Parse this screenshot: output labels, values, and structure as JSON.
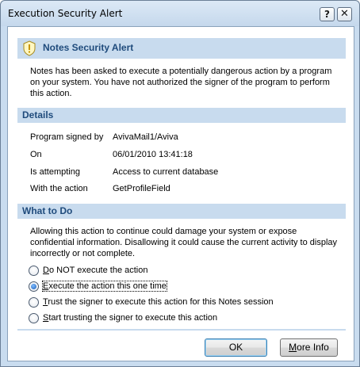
{
  "window": {
    "title": "Execution Security Alert",
    "help_glyph": "?",
    "close_glyph": "✕"
  },
  "alert": {
    "title": "Notes Security Alert",
    "message": "Notes has been asked to execute a potentially dangerous action by a program on your system.  You have not authorized the signer of the program to perform this action."
  },
  "details": {
    "header": "Details",
    "rows": [
      {
        "label": "Program signed by",
        "value": "AvivaMail1/Aviva"
      },
      {
        "label": "On",
        "value": "06/01/2010 13:41:18"
      },
      {
        "label": "Is attempting",
        "value": "Access to current database"
      },
      {
        "label": "With the action",
        "value": "GetProfileField"
      }
    ]
  },
  "what_to_do": {
    "header": "What to Do",
    "message": "Allowing this action to continue could damage your system or expose confidential information. Disallowing it could cause the current activity to display incorrectly or not complete.",
    "options": [
      {
        "mnemonic": "D",
        "rest": "o NOT execute the action",
        "checked": false
      },
      {
        "mnemonic": "E",
        "rest": "xecute the action this one time",
        "checked": true
      },
      {
        "mnemonic": "T",
        "rest": "rust the signer to execute this action for this Notes session",
        "checked": false
      },
      {
        "mnemonic": "S",
        "rest": "tart trusting the signer to execute this action",
        "checked": false
      }
    ]
  },
  "buttons": {
    "ok": "OK",
    "more_mnemonic": "M",
    "more_rest": "ore Info"
  },
  "colors": {
    "header_bg": "#c8dbee",
    "header_text": "#1f4b7c",
    "frame": "#c9dcef"
  },
  "icons": {
    "alert": "security-alert-icon"
  }
}
